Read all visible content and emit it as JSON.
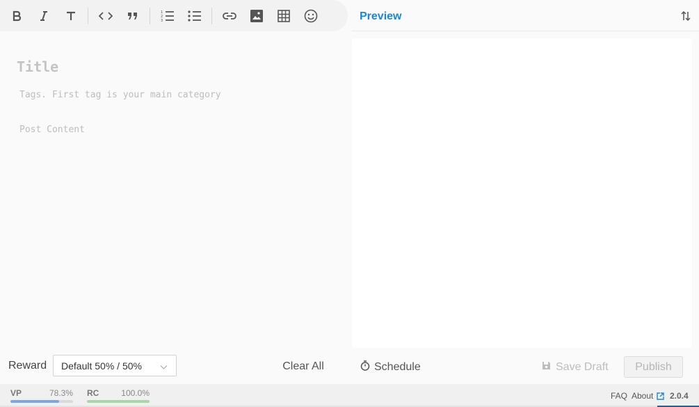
{
  "editor": {
    "title_placeholder": "Title",
    "tags_placeholder": "Tags. First tag is your main category",
    "content_placeholder": "Post Content",
    "reward_label": "Reward",
    "reward_value": "Default 50% / 50%",
    "clear_label": "Clear All"
  },
  "preview": {
    "title": "Preview",
    "schedule_label": "Schedule",
    "save_draft_label": "Save Draft",
    "publish_label": "Publish"
  },
  "footer": {
    "vp_label": "VP",
    "vp_value": "78.3%",
    "vp_fraction": 0.783,
    "rc_label": "RC",
    "rc_value": "100.0%",
    "rc_fraction": 1.0,
    "faq_label": "FAQ",
    "about_label": "About",
    "version": "2.0.4"
  },
  "colors": {
    "accent": "#1b86d8",
    "vp_bar": "#7aa7e6",
    "rc_bar": "#a9d7a6"
  },
  "icons": [
    "bold-icon",
    "italic-icon",
    "heading-icon",
    "code-icon",
    "quote-icon",
    "ordered-list-icon",
    "unordered-list-icon",
    "link-icon",
    "image-icon",
    "table-icon",
    "emoji-icon",
    "sort-icon",
    "timer-icon",
    "save-icon",
    "external-link-icon",
    "chevron-down-icon"
  ]
}
